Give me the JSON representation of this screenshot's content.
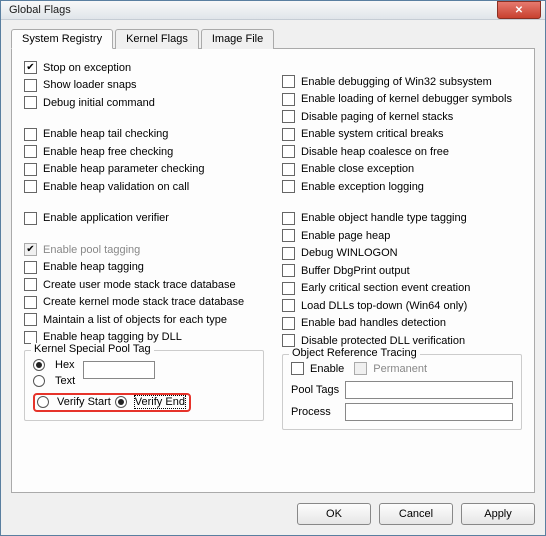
{
  "window": {
    "title": "Global Flags"
  },
  "tabs": {
    "t0": "System Registry",
    "t1": "Kernel Flags",
    "t2": "Image File",
    "active": 0
  },
  "left": {
    "stop_exc": {
      "label": "Stop on exception",
      "checked": true
    },
    "show_ldr": {
      "label": "Show loader snaps",
      "checked": false
    },
    "dbg_init": {
      "label": "Debug initial command",
      "checked": false
    },
    "heap_tail": {
      "label": "Enable heap tail checking",
      "checked": false
    },
    "heap_free": {
      "label": "Enable heap free checking",
      "checked": false
    },
    "heap_param": {
      "label": "Enable heap parameter checking",
      "checked": false
    },
    "heap_valid": {
      "label": "Enable heap validation on call",
      "checked": false
    },
    "app_ver": {
      "label": "Enable application verifier",
      "checked": false
    },
    "pool_tag": {
      "label": "Enable pool tagging",
      "checked": true,
      "disabled": true
    },
    "heap_tag": {
      "label": "Enable heap tagging",
      "checked": false
    },
    "usr_stack": {
      "label": "Create user mode stack trace database",
      "checked": false
    },
    "krn_stack": {
      "label": "Create kernel mode stack trace database",
      "checked": false
    },
    "maint_list": {
      "label": "Maintain a list of objects for each type",
      "checked": false
    },
    "heap_tagdll": {
      "label": "Enable heap tagging by DLL",
      "checked": false
    }
  },
  "right": {
    "dbg_w32": {
      "label": "Enable debugging of Win32 subsystem",
      "checked": false
    },
    "load_sym": {
      "label": "Enable loading of kernel debugger symbols",
      "checked": false
    },
    "dis_paging": {
      "label": "Disable paging of kernel stacks",
      "checked": false
    },
    "sys_crit": {
      "label": "Enable system critical breaks",
      "checked": false
    },
    "coalesce": {
      "label": "Disable heap coalesce on free",
      "checked": false
    },
    "close_exc": {
      "label": "Enable close exception",
      "checked": false
    },
    "exc_log": {
      "label": "Enable exception logging",
      "checked": false
    },
    "obj_type": {
      "label": "Enable object handle type tagging",
      "checked": false
    },
    "page_heap": {
      "label": "Enable page heap",
      "checked": false
    },
    "dbg_winlog": {
      "label": "Debug WINLOGON",
      "checked": false
    },
    "buf_dbgp": {
      "label": "Buffer DbgPrint output",
      "checked": false
    },
    "early_crit": {
      "label": "Early critical section event creation",
      "checked": false
    },
    "load_td": {
      "label": "Load DLLs top-down (Win64 only)",
      "checked": false
    },
    "bad_handle": {
      "label": "Enable bad handles detection",
      "checked": false
    },
    "dis_pdv": {
      "label": "Disable protected DLL verification",
      "checked": false
    }
  },
  "pool": {
    "title": "Kernel Special Pool Tag",
    "hex": "Hex",
    "text": "Text",
    "mode": "hex",
    "value": "",
    "verify_start": "Verify Start",
    "verify_end": "Verify End",
    "verify": "end"
  },
  "ort": {
    "title": "Object Reference Tracing",
    "enable": "Enable",
    "enable_checked": false,
    "permanent": "Permanent",
    "permanent_disabled": true,
    "pool_tags_label": "Pool Tags",
    "pool_tags_value": "",
    "process_label": "Process",
    "process_value": ""
  },
  "buttons": {
    "ok": "OK",
    "cancel": "Cancel",
    "apply": "Apply"
  }
}
